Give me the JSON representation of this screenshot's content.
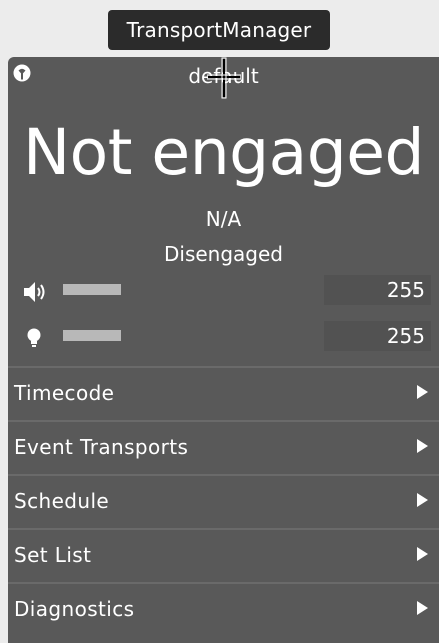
{
  "tooltip": {
    "text": "TransportManager"
  },
  "preset": {
    "name": "default",
    "icon": "preset-menu-icon"
  },
  "status": {
    "state": "Not engaged",
    "value": "N/A",
    "detail": "Disengaged"
  },
  "controls": {
    "volume": {
      "icon": "speaker-icon",
      "value": "255",
      "level": 1.0
    },
    "brightness": {
      "icon": "lightbulb-icon",
      "value": "255",
      "level": 1.0
    }
  },
  "menu": {
    "items": [
      {
        "label": "Timecode"
      },
      {
        "label": "Event Transports"
      },
      {
        "label": "Schedule"
      },
      {
        "label": "Set List"
      },
      {
        "label": "Diagnostics"
      }
    ]
  },
  "colors": {
    "panel": "#595959",
    "tooltip": "#2b2b2b",
    "text": "#ffffff"
  }
}
